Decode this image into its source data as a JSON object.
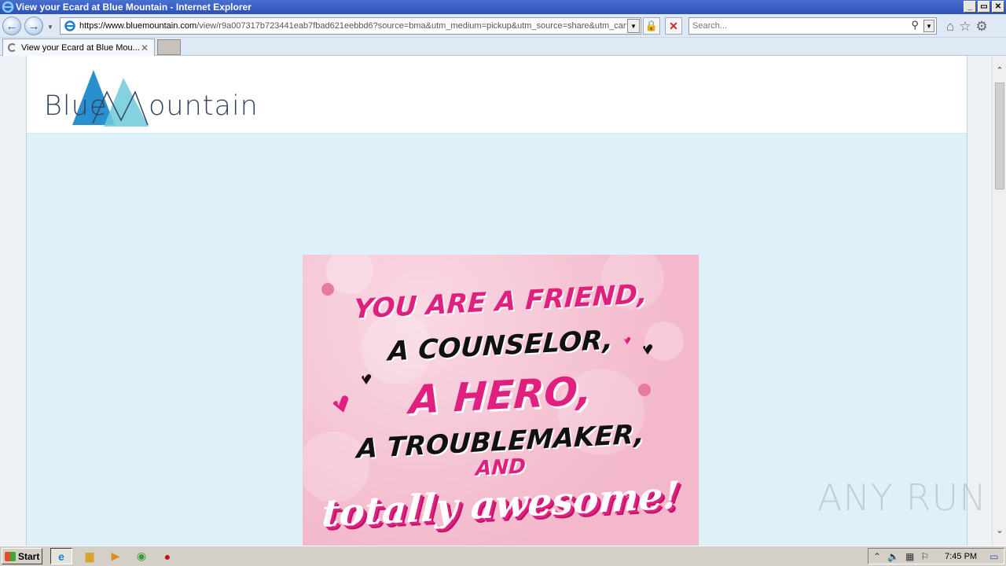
{
  "window": {
    "title": "View your Ecard at Blue Mountain - Internet Explorer",
    "controls": {
      "minimize": "_",
      "restore": "▭",
      "close": "✕"
    }
  },
  "navbar": {
    "url_domain": "https://www.bluemountain.com",
    "url_path": "/view/r9a007317b723441eab7fbad621eebbd6?source=bma&utm_medium=pickup&utm_source=share&utm_camp",
    "search_placeholder": "Search..."
  },
  "tabs": [
    {
      "title": "View your Ecard at Blue Mou...",
      "loading": true
    }
  ],
  "site": {
    "logo_left": "Blue",
    "logo_right": "ountain",
    "brand_colors": {
      "mountain_dark": "#2a8fcf",
      "mountain_light": "#6ec9d9",
      "text": "#33455f",
      "page_bg": "#dff1f8"
    }
  },
  "card": {
    "lines": [
      "YOU ARE A FRIEND,",
      "A COUNSELOR,",
      "A HERO,",
      "A TROUBLEMAKER,",
      "AND",
      "totally awesome!"
    ],
    "colors": {
      "pink": "#e0207f",
      "black": "#111111",
      "background": "#f3b8cb"
    }
  },
  "watermark": "ANY RUN",
  "taskbar": {
    "start_label": "Start",
    "apps": [
      "ie-icon",
      "explorer-icon",
      "media-player-icon",
      "chrome-icon",
      "opera-icon"
    ],
    "clock": "7:45 PM"
  }
}
